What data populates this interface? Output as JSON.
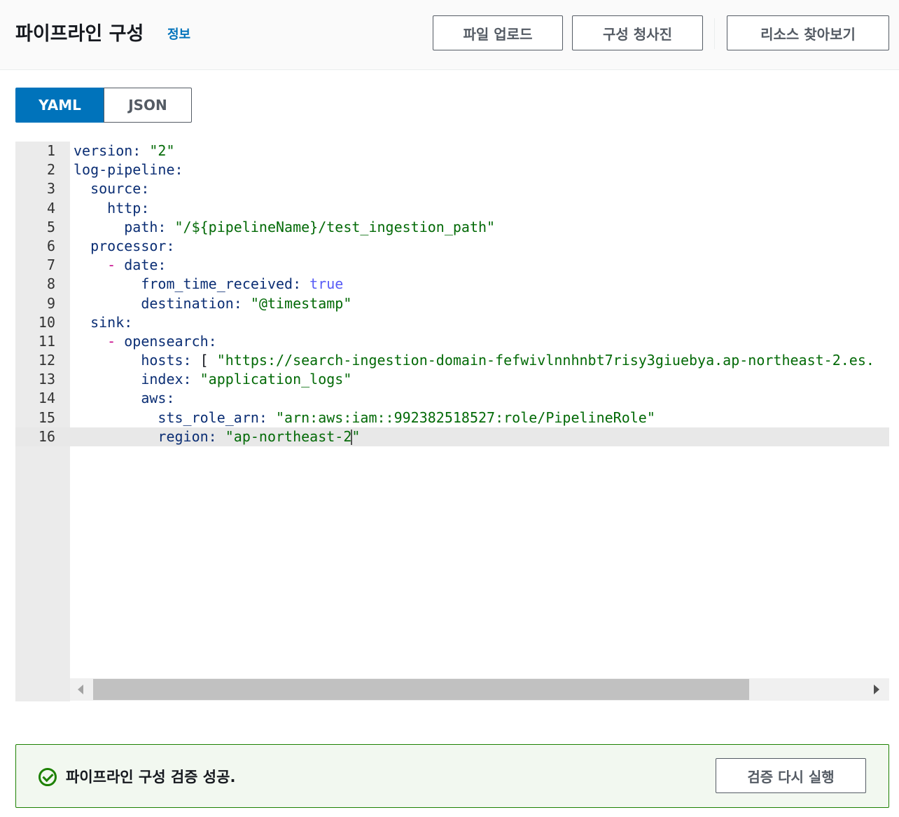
{
  "header": {
    "title": "파이프라인 구성",
    "info_link": "정보",
    "buttons": {
      "upload": "파일 업로드",
      "blueprint": "구성 청사진",
      "resources": "리소스 찾아보기"
    }
  },
  "tabs": {
    "yaml": "YAML",
    "json": "JSON",
    "selected": "YAML"
  },
  "editor": {
    "active_line": 16,
    "line_numbers": [
      "1",
      "2",
      "3",
      "4",
      "5",
      "6",
      "7",
      "8",
      "9",
      "10",
      "11",
      "12",
      "13",
      "14",
      "15",
      "16"
    ],
    "lines": {
      "l1_key": "version:",
      "l1_val": "\"2\"",
      "l2_key": "log-pipeline:",
      "l3_key": "source:",
      "l4_key": "http:",
      "l5_key": "path:",
      "l5_val": "\"/${pipelineName}/test_ingestion_path\"",
      "l6_key": "processor:",
      "l7_dash": "-",
      "l7_key": "date:",
      "l8_key": "from_time_received:",
      "l8_val": "true",
      "l9_key": "destination:",
      "l9_val": "\"@timestamp\"",
      "l10_key": "sink:",
      "l11_dash": "-",
      "l11_key": "opensearch:",
      "l12_key": "hosts:",
      "l12_bracket": "[",
      "l12_val": "\"https://search-ingestion-domain-fefwivlnnhnbt7risy3giuebya.ap-northeast-2.es.",
      "l13_key": "index:",
      "l13_val": "\"application_logs\"",
      "l14_key": "aws:",
      "l15_key": "sts_role_arn:",
      "l15_val": "\"arn:aws:iam::992382518527:role/PipelineRole\"",
      "l16_key": "region:",
      "l16_val_a": "\"ap-northeast-2",
      "l16_val_b": "\""
    }
  },
  "alert": {
    "status": "success",
    "message": "파이프라인 구성 검증 성공.",
    "revalidate_button": "검증 다시 실행"
  },
  "colors": {
    "accent": "#0073bb",
    "success": "#1d8102",
    "key": "#0b2e74",
    "string": "#036a07",
    "boolean": "#585cf6",
    "dash": "#c80a8c"
  }
}
